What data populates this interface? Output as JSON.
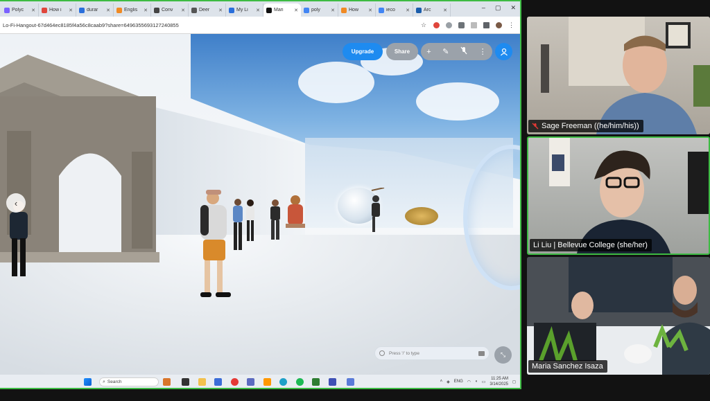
{
  "browser": {
    "tabs": [
      {
        "label": "Polyc",
        "color": "#7b61ff"
      },
      {
        "label": "How i",
        "color": "#e0463c"
      },
      {
        "label": "durar",
        "color": "#2a6fdb"
      },
      {
        "label": "Englis",
        "color": "#f08a24"
      },
      {
        "label": "Conv",
        "color": "#444444"
      },
      {
        "label": "Deer",
        "color": "#555555"
      },
      {
        "label": "My Li",
        "color": "#2a6fdb"
      },
      {
        "label": "Mari",
        "color": "#111111"
      },
      {
        "label": "poly",
        "color": "#4285f4"
      },
      {
        "label": "How",
        "color": "#f08a24"
      },
      {
        "label": "ieco",
        "color": "#4285f4"
      },
      {
        "label": "Arc",
        "color": "#1a5dab"
      }
    ],
    "active_tab_index": 7,
    "url": "Lo-Fi-Hangout-67d464ec8185f4a56c8caab9?share=6496355693127240855"
  },
  "app": {
    "upgrade_label": "Upgrade",
    "share_label": "Share",
    "tool_icons": [
      "plus-icon",
      "pencil-icon",
      "mic-off-icon",
      "more-icon"
    ],
    "chat_placeholder": "Press '/' to type"
  },
  "taskbar": {
    "search_label": "Search",
    "language": "ENG",
    "time": "11:25 AM",
    "date": "3/14/2025"
  },
  "participants": [
    {
      "name": "Sage Freeman ((he/him/his))",
      "muted": true,
      "speaking": false
    },
    {
      "name": "Li Liu | Bellevue College (she/her)",
      "muted": false,
      "speaking": true
    },
    {
      "name": "Maria Sanchez Isaza",
      "muted": false,
      "speaking": false
    }
  ],
  "colors": {
    "speaking_border": "#3dbb43",
    "accent_blue": "#1e8bf0"
  }
}
